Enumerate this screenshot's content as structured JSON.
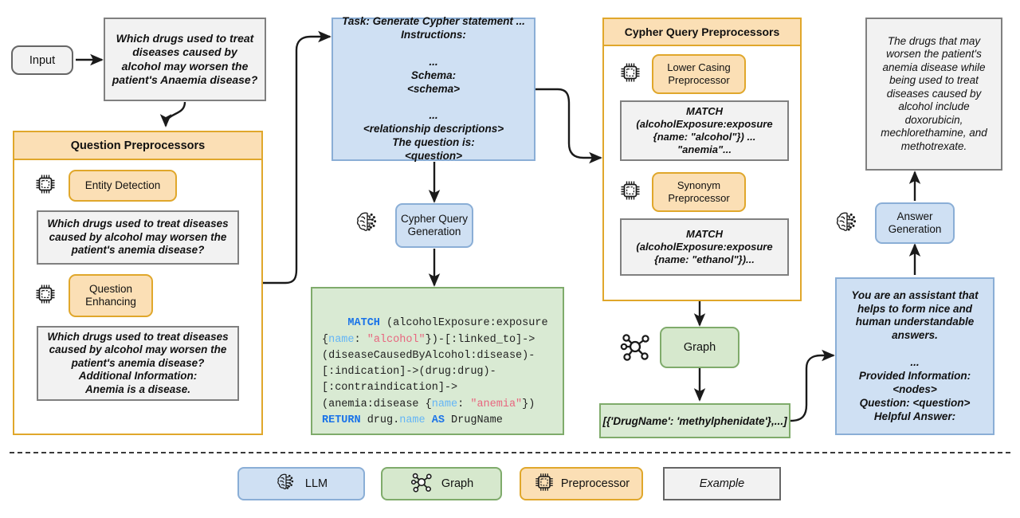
{
  "diagram": {
    "title": "Knowledge-graph RAG pipeline",
    "colors": {
      "llm_fill": "#cfe0f3",
      "llm_stroke": "#8aaed6",
      "graph_fill": "#d9ead3",
      "graph_stroke": "#7fab6b",
      "preprocessor_fill": "#fbdfb5",
      "preprocessor_stroke": "#e0a72b",
      "example_fill": "#f2f2f2",
      "example_stroke": "#666666",
      "arrow": "#1a1a1a",
      "code_keyword": "#1a73e8",
      "code_property": "#64b5f6",
      "code_string": "#e8667f"
    }
  },
  "input": {
    "label": "Input",
    "question": "Which drugs used to treat diseases caused by alcohol may worsen the patient's Anaemia disease?"
  },
  "question_preprocessors": {
    "header": "Question Preprocessors",
    "steps": [
      {
        "icon": "chip-icon",
        "label": "Entity Detection",
        "example_prefix": "Which drugs used to treat diseases caused by alcohol may worsen the patient's ",
        "example_bold": "anemia disease",
        "example_suffix": "?"
      },
      {
        "icon": "chip-icon",
        "label": "Question Enhancing",
        "example_line1": "Which drugs used to treat diseases caused by alcohol may worsen the patient's anemia disease?",
        "example_bold1": "Additional Information:",
        "example_bold2": "Anemia is a disease."
      }
    ]
  },
  "cypher_prompt": {
    "lines": [
      "Task: Generate Cypher statement ...",
      "Instructions:",
      "...",
      "Schema:",
      "<schema>",
      "...",
      "<relationship descriptions>",
      "The question is:",
      "<question>"
    ]
  },
  "cypher_generation": {
    "icon": "brain-icon",
    "label": "Cypher Query Generation"
  },
  "cypher_code": {
    "tokens": [
      {
        "t": "MATCH",
        "c": "kw"
      },
      {
        "t": " (alcoholExposure:exposure\n{",
        "c": "pl"
      },
      {
        "t": "name",
        "c": "prop"
      },
      {
        "t": ": ",
        "c": "pl"
      },
      {
        "t": "\"alcohol\"",
        "c": "str"
      },
      {
        "t": "})-[:linked_to]->\n(diseaseCausedByAlcohol:disease)-\n[:indication]->(drug:drug)-\n[:contraindication]->\n(anemia:disease {",
        "c": "pl"
      },
      {
        "t": "name",
        "c": "prop"
      },
      {
        "t": ": ",
        "c": "pl"
      },
      {
        "t": "\"anemia\"",
        "c": "str"
      },
      {
        "t": "})\n",
        "c": "pl"
      },
      {
        "t": "RETURN",
        "c": "kw"
      },
      {
        "t": " drug.",
        "c": "pl"
      },
      {
        "t": "name",
        "c": "prop"
      },
      {
        "t": " ",
        "c": "pl"
      },
      {
        "t": "AS",
        "c": "kw"
      },
      {
        "t": " DrugName",
        "c": "pl"
      }
    ]
  },
  "cypher_preprocessors": {
    "header": "Cypher Query Preprocessors",
    "steps": [
      {
        "icon": "chip-icon",
        "label": "Lower Casing Preprocessor",
        "example_line1": "MATCH",
        "example_line2": "(alcoholExposure:exposure",
        "example_line3_prefix": "{name: ",
        "example_line3_bold": "\"alcohol\"",
        "example_line3_suffix": "}) ...",
        "example_line4_bold": "\"anemia\"",
        "example_line4_suffix": "..."
      },
      {
        "icon": "chip-icon",
        "label": "Synonym Preprocessor",
        "example_line1": "MATCH",
        "example_line2": "(alcoholExposure:exposure",
        "example_line3_prefix": "{name: ",
        "example_line3_bold": "\"ethanol\"",
        "example_line3_suffix": "})..."
      }
    ]
  },
  "graph": {
    "icon": "graph-icon",
    "label": "Graph",
    "result": "[{'DrugName': 'methylphenidate'},...]"
  },
  "answer_prompt": {
    "lines": [
      "You are an assistant that helps to form nice and human understandable answers.",
      "...",
      "Provided Information:",
      "<nodes>",
      "Question: <question>",
      "Helpful Answer:"
    ]
  },
  "answer_generation": {
    "icon": "brain-icon",
    "label": "Answer Generation"
  },
  "final_answer": {
    "text": "The drugs that may worsen the patient's anemia disease while being used to treat diseases caused by alcohol include doxorubicin, mechlorethamine, and methotrexate."
  },
  "legend": {
    "items": [
      {
        "icon": "brain-icon",
        "label": "LLM"
      },
      {
        "icon": "graph-icon",
        "label": "Graph"
      },
      {
        "icon": "chip-icon",
        "label": "Preprocessor"
      },
      {
        "icon": "none",
        "label": "Example"
      }
    ]
  }
}
